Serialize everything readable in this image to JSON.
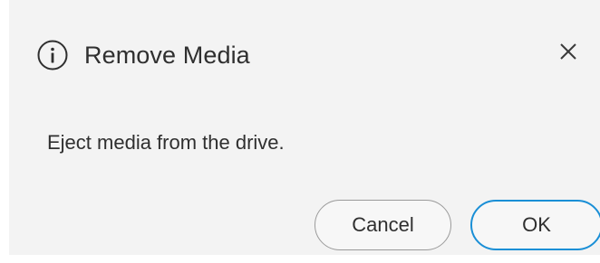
{
  "dialog": {
    "title": "Remove Media",
    "message": "Eject media from the drive.",
    "icon": "info-icon",
    "close_icon": "close-icon",
    "buttons": {
      "cancel_label": "Cancel",
      "ok_label": "OK"
    }
  },
  "colors": {
    "background": "#f3f3f3",
    "text": "#2f2f2f",
    "primary_border": "#1a8fd6",
    "secondary_border": "#9a9a9a"
  }
}
